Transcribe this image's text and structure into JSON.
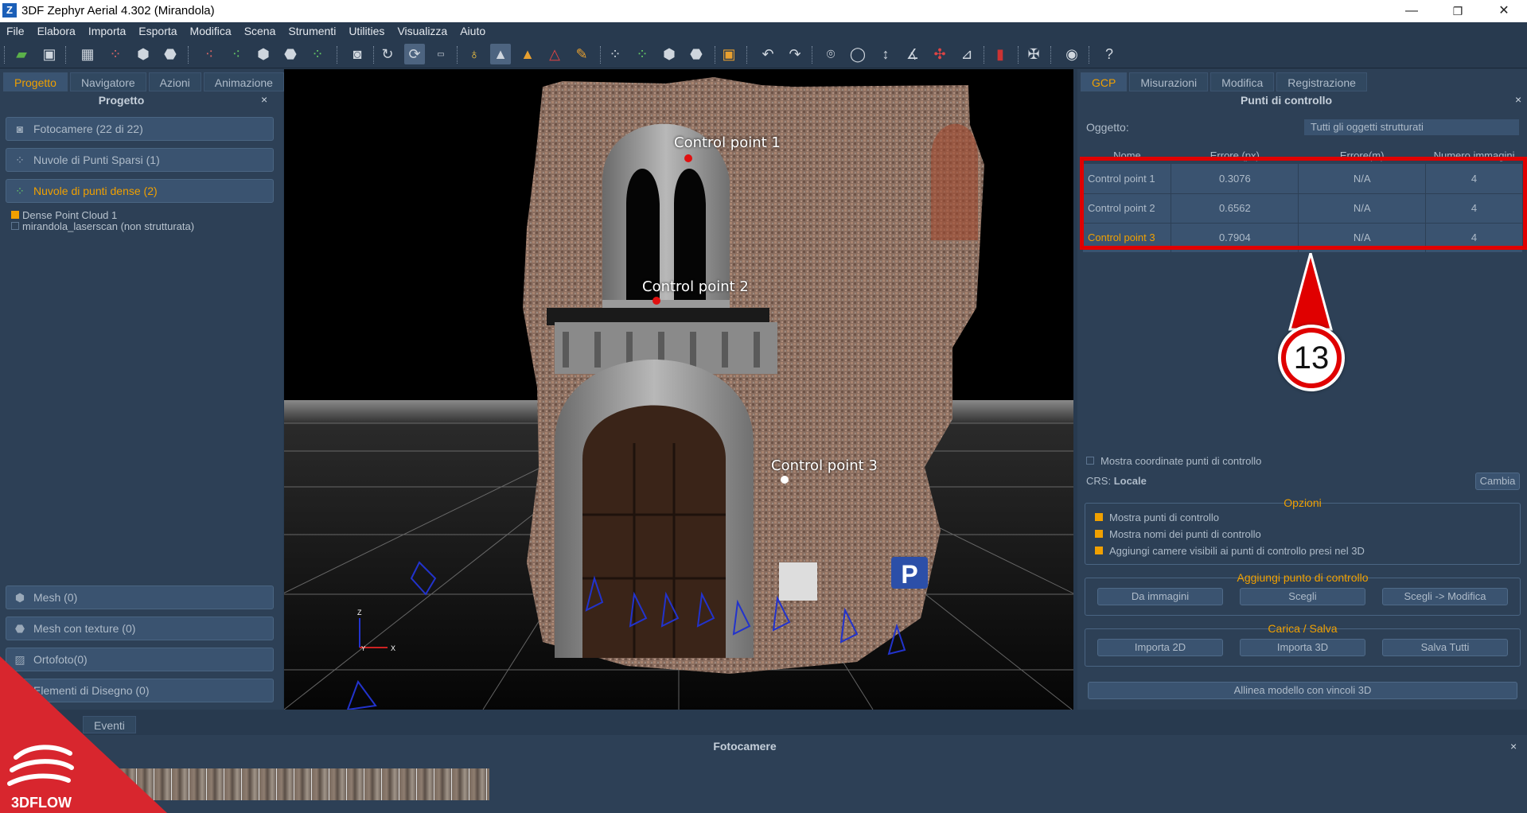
{
  "window": {
    "title": "3DF Zephyr Aerial 4.302 (Mirandola)",
    "logo_letter": "Z",
    "minimize": "—",
    "restore": "❐",
    "close": "✕"
  },
  "menu": [
    "File",
    "Elabora",
    "Importa",
    "Esporta",
    "Modifica",
    "Scena",
    "Strumenti",
    "Utilities",
    "Visualizza",
    "Aiuto"
  ],
  "left_panel": {
    "tabs": [
      "Progetto",
      "Navigatore",
      "Azioni",
      "Animazione"
    ],
    "active_tab": "Progetto",
    "title": "Progetto",
    "close": "×",
    "sections": {
      "cameras": "Fotocamere (22 di 22)",
      "sparse": "Nuvole di Punti Sparsi (1)",
      "dense": "Nuvole di punti dense (2)",
      "mesh": "Mesh (0)",
      "textured_mesh": "Mesh con texture (0)",
      "orthophoto": "Ortofoto(0)",
      "drawing": "Elementi di Disegno (0)"
    },
    "dense_items": [
      "Dense Point Cloud 1",
      "mirandola_laserscan (non strutturata)"
    ]
  },
  "viewport": {
    "points": [
      "Control point 1",
      "Control point 2",
      "Control point 3"
    ],
    "axis_z": "Z",
    "axis_y": "Y",
    "axis_x": "X"
  },
  "right_panel": {
    "tabs": [
      "GCP",
      "Misurazioni",
      "Modifica",
      "Registrazione"
    ],
    "active_tab": "GCP",
    "title": "Punti di controllo",
    "close": "×",
    "object_label": "Oggetto:",
    "object_value": "Tutti gli oggetti strutturati",
    "columns": [
      "Nome",
      "Errore (px)",
      "Errore(m)",
      "Numero immagini"
    ],
    "rows": [
      {
        "name": "Control point 1",
        "err_px": "0.3076",
        "err_m": "N/A",
        "images": "4"
      },
      {
        "name": "Control point 2",
        "err_px": "0.6562",
        "err_m": "N/A",
        "images": "4"
      },
      {
        "name": "Control point 3",
        "err_px": "0.7904",
        "err_m": "N/A",
        "images": "4"
      }
    ],
    "selected_row": 2,
    "step_badge": "13",
    "show_coords": "Mostra coordinate punti di controllo",
    "crs_label": "CRS:",
    "crs_value": "Locale",
    "change_btn": "Cambia",
    "options_title": "Opzioni",
    "options": [
      "Mostra punti di controllo",
      "Mostra nomi dei punti di controllo",
      "Aggiungi camere visibili ai punti di controllo presi nel 3D"
    ],
    "add_title": "Aggiungi punto di controllo",
    "add_buttons": [
      "Da immagini",
      "Scegli",
      "Scegli -> Modifica"
    ],
    "load_title": "Carica / Salva",
    "load_buttons": [
      "Importa 2D",
      "Importa 3D",
      "Salva Tutti"
    ],
    "align_btn": "Allinea modello con vincoli 3D"
  },
  "bottom": {
    "tabs": [
      "Eventi"
    ],
    "title": "Fotocamere",
    "close": "×"
  },
  "brand": {
    "text": "3DFLOW"
  },
  "colors": {
    "accent": "#f0a000",
    "highlight": "#e00000",
    "panel": "#2d4056",
    "toolbar": "#283a4f"
  }
}
